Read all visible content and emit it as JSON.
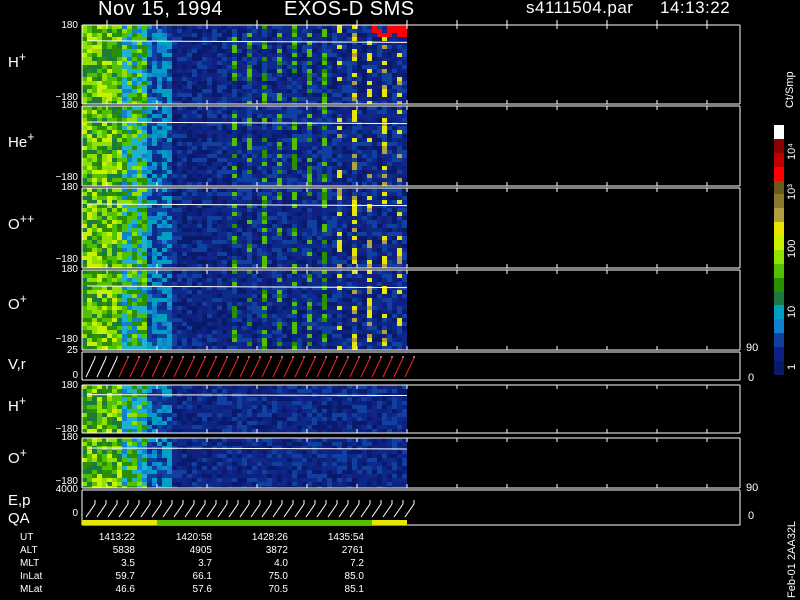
{
  "header": {
    "date": "Nov 15, 1994",
    "instrument": "EXOS-D SMS",
    "file": "s4111504.par",
    "time": "14:13:22"
  },
  "panels": [
    {
      "id": "h_plus_1",
      "species": "H",
      "charge": "+",
      "top_tick": "180",
      "bottom_tick": "−180"
    },
    {
      "id": "he_plus",
      "species": "He",
      "charge": "+",
      "top_tick": "180",
      "bottom_tick": "−180"
    },
    {
      "id": "o_pp",
      "species": "O",
      "charge": "++",
      "top_tick": "180",
      "bottom_tick": "−180"
    },
    {
      "id": "o_plus_1",
      "species": "O",
      "charge": "+",
      "top_tick": "180",
      "bottom_tick": "−180"
    },
    {
      "id": "h_plus_2",
      "species": "H",
      "charge": "+",
      "top_tick": "180",
      "bottom_tick": "−180"
    },
    {
      "id": "o_plus_2",
      "species": "O",
      "charge": "+",
      "top_tick": "180",
      "bottom_tick": "−180"
    }
  ],
  "vr_panel": {
    "label": "V,r",
    "left_top": "25",
    "left_bottom": "0",
    "right_top": "90",
    "right_bottom": "0"
  },
  "ep_panel": {
    "label_top": "E,p",
    "label_bottom": "QA",
    "left_top": "4000",
    "left_bottom": "0",
    "right_top": "90",
    "right_bottom": "0"
  },
  "colorbar": {
    "unit": "Ct/Smp",
    "ticks": [
      "10⁴",
      "10³",
      "100",
      "10",
      "1"
    ],
    "colors": [
      "#ffffff",
      "#8b0000",
      "#c00000",
      "#ff0000",
      "#6b5a1e",
      "#8a7a2a",
      "#b0a040",
      "#e6e600",
      "#c8f000",
      "#90e000",
      "#50c000",
      "#2a9000",
      "#1a7a40",
      "#00a0c0",
      "#1080d0",
      "#1040a0",
      "#102080",
      "#0a1a6a"
    ]
  },
  "orbit_info": {
    "rows": [
      {
        "label": "UT",
        "values": [
          "1413:22",
          "1420:58",
          "1428:26",
          "1435:54"
        ]
      },
      {
        "label": "ALT",
        "values": [
          "5838",
          "4905",
          "3872",
          "2761"
        ]
      },
      {
        "label": "MLT",
        "values": [
          "3.5",
          "3.7",
          "4.0",
          "7.2"
        ]
      },
      {
        "label": "InLat",
        "values": [
          "59.7",
          "66.1",
          "75.0",
          "85.0"
        ]
      },
      {
        "label": "MLat",
        "values": [
          "46.6",
          "57.6",
          "70.5",
          "85.1"
        ]
      }
    ]
  },
  "footer_code": "Feb-01 2AA32L"
}
